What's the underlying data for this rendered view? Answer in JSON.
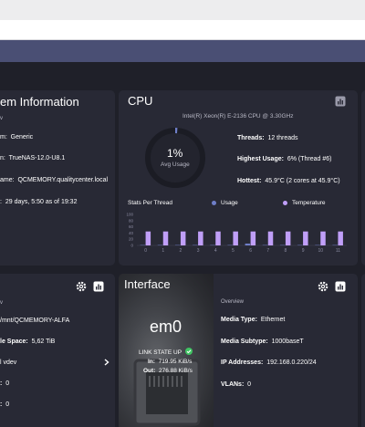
{
  "system_info": {
    "title": "em Information",
    "rows": [
      {
        "label": "m:",
        "value": "Generic"
      },
      {
        "label": "n:",
        "value": "TrueNAS-12.0-U8.1"
      },
      {
        "label": "ame:",
        "value": "QCMEMORY.qualitycenter.local"
      },
      {
        "label": "",
        "value": "29 days, 5:50 as of 19:32"
      }
    ]
  },
  "cpu": {
    "title": "CPU",
    "model": "Intel(R) Xeon(R) E-2136 CPU @ 3.30GHz",
    "avg_value": "1%",
    "avg_label": "Avg Usage",
    "avg_fraction": 0.01,
    "threads_label": "Threads:",
    "threads_value": "12 threads",
    "highest_label": "Highest Usage:",
    "highest_value": "6%  (Thread #6)",
    "hottest_label": "Hottest:",
    "hottest_value": "45.9°C  (2 cores at 45.9°C)",
    "stats_label": "Stats Per Thread",
    "legend_usage": "Usage",
    "legend_temp": "Temperature",
    "colors": {
      "usage": "#6f7ec8",
      "temperature": "#c09ff8"
    }
  },
  "chart_data": {
    "type": "bar",
    "categories": [
      "0",
      "1",
      "2",
      "3",
      "4",
      "5",
      "6",
      "7",
      "8",
      "9",
      "10",
      "11"
    ],
    "series": [
      {
        "name": "Usage",
        "values": [
          1,
          1,
          1,
          1,
          1,
          1,
          6,
          1,
          1,
          1,
          1,
          1
        ]
      },
      {
        "name": "Temperature",
        "values": [
          45,
          45,
          45,
          45,
          45,
          45,
          45,
          45,
          45,
          45,
          45,
          45
        ]
      }
    ],
    "yticks": [
      "100",
      "80",
      "60",
      "40",
      "20",
      "0"
    ],
    "ylim": [
      0,
      100
    ]
  },
  "pool": {
    "path": "/mnt/QCMEMORY-ALFA",
    "space_label": "le Space:",
    "space_value": "5,62 TiB",
    "vdev": "l vdev",
    "row4_label": ":",
    "row4_value": "0",
    "row5_label": ":",
    "row5_value": "0"
  },
  "interface": {
    "title": "Interface",
    "name": "em0",
    "link_state": "LINK STATE UP",
    "in_label": "In:",
    "in_value": "719.95 KiB/s",
    "out_label": "Out:",
    "out_value": "276.88 KiB/s",
    "overview": "Overview",
    "media_type_label": "Media Type:",
    "media_type_value": "Ethernet",
    "media_subtype_label": "Media Subtype:",
    "media_subtype_value": "1000baseT",
    "ip_label": "IP Addresses:",
    "ip_value": "192.168.0.220/24",
    "vlans_label": "VLANs:",
    "vlans_value": "0"
  }
}
